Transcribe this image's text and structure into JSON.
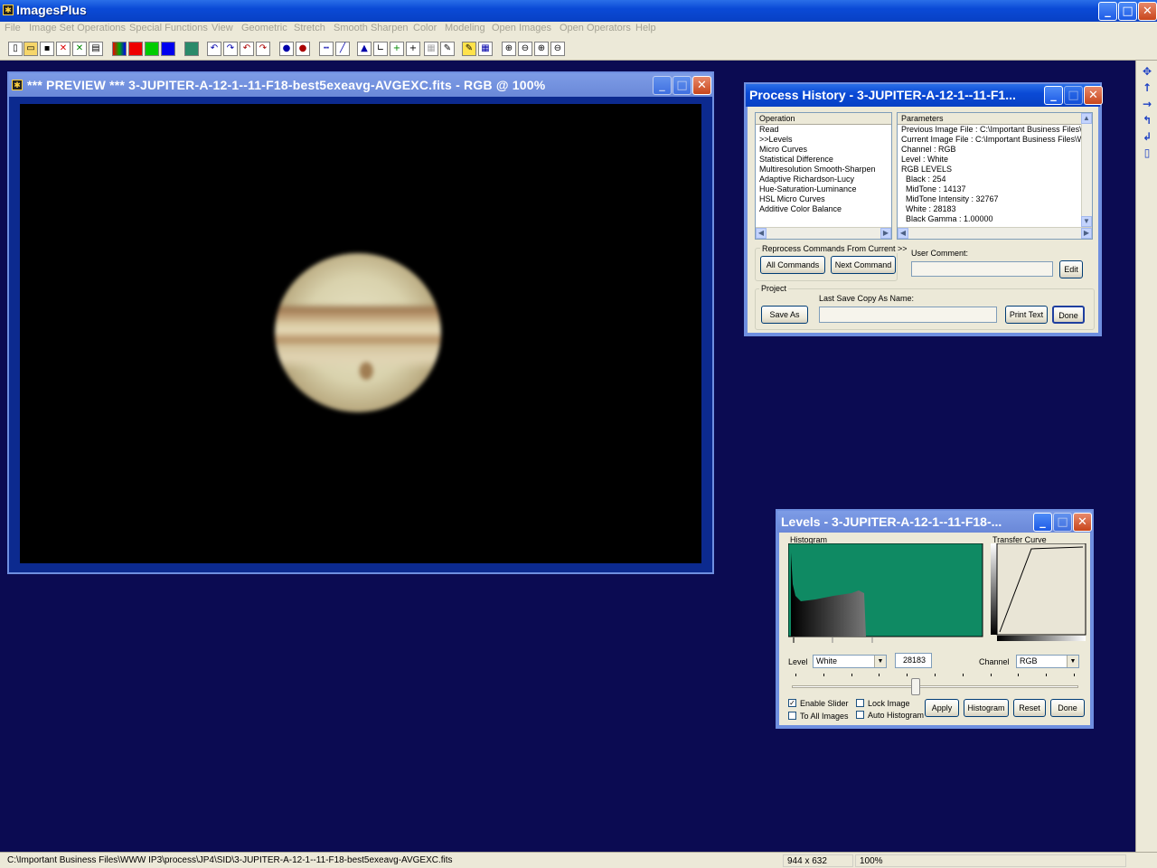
{
  "app": {
    "title": "ImagesPlus"
  },
  "menu": [
    "File",
    "Image Set Operations",
    "Special Functions",
    "View",
    "Geometric",
    "Stretch",
    "Smooth Sharpen",
    "Color",
    "Modeling",
    "Open Images",
    "Open Operators",
    "Help"
  ],
  "preview": {
    "title": "*** PREVIEW *** 3-JUPITER-A-12-1--11-F18-best5exeavg-AVGEXC.fits - RGB @  100%"
  },
  "process_history": {
    "title": "Process History - 3-JUPITER-A-12-1--11-F1...",
    "operation_header": "Operation",
    "operations": [
      "Read",
      ">>Levels",
      "Micro Curves",
      "Statistical Difference",
      "Multiresolution Smooth-Sharpen",
      "Adaptive Richardson-Lucy",
      "Hue-Saturation-Luminance",
      "HSL Micro Curves",
      "Additive Color Balance"
    ],
    "parameters_header": "Parameters",
    "parameters": [
      "Previous Image File : C:\\Important Business Files\\W",
      "Current Image File : C:\\Important Business Files\\WW",
      "Channel : RGB",
      "Level : White",
      "RGB LEVELS",
      "  Black : 254",
      "  MidTone : 14137",
      "  MidTone Intensity : 32767",
      "  White : 28183",
      "  Black Gamma : 1.00000"
    ],
    "reprocess_label": "Reprocess Commands From Current >>",
    "all_commands": "All Commands",
    "next_command": "Next Command",
    "user_comment_label": "User Comment:",
    "edit": "Edit",
    "project_label": "Project",
    "last_save_label": "Last Save Copy As Name:",
    "save_as": "Save As",
    "print_text": "Print Text",
    "done": "Done"
  },
  "levels": {
    "title": "Levels - 3-JUPITER-A-12-1--11-F18-...",
    "histogram_label": "Histogram",
    "transfer_label": "Transfer Curve",
    "level_label": "Level",
    "level_value": "White",
    "value": "28183",
    "channel_label": "Channel",
    "channel_value": "RGB",
    "enable_slider": "Enable Slider",
    "to_all_images": "To All Images",
    "lock_image": "Lock Image",
    "auto_histogram": "Auto Histogram",
    "apply": "Apply",
    "histogram_btn": "Histogram",
    "reset": "Reset",
    "done": "Done",
    "slider_position": 0.43,
    "histogram_color": "#0f8a63"
  },
  "status": {
    "path": "C:\\Important Business Files\\WWW IP3\\process\\JP4\\SID\\3-JUPITER-A-12-1--11-F18-best5exeavg-AVGEXC.fits",
    "dims": "944 x 632",
    "zoom": "100%"
  }
}
